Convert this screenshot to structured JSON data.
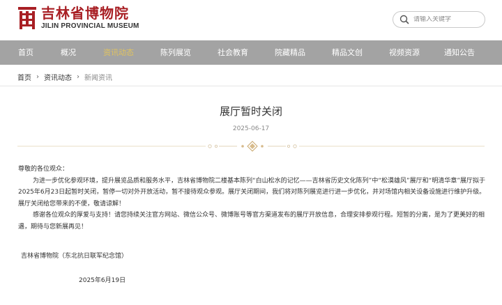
{
  "header": {
    "logo_cn": "吉林省博物院",
    "logo_en": "JILIN PROVINCIAL MUSEUM",
    "search_placeholder": "请输入关键字",
    "brand_color": "#a81f24"
  },
  "nav": {
    "items": [
      {
        "label": "首页"
      },
      {
        "label": "概况"
      },
      {
        "label": "资讯动态",
        "active": true
      },
      {
        "label": "陈列展览"
      },
      {
        "label": "社会教育"
      },
      {
        "label": "院藏精品"
      },
      {
        "label": "精品文创"
      },
      {
        "label": "视频资源"
      },
      {
        "label": "通知公告"
      }
    ],
    "background": "#a3a3a3",
    "active_color": "#e1c35e"
  },
  "breadcrumb": {
    "home": "首页",
    "section": "资讯动态",
    "current": "新闻资讯"
  },
  "article": {
    "title": "展厅暂时关闭",
    "date": "2025-06-17",
    "greeting": "尊敬的各位观众：",
    "paragraph1": "为进一步优化参观环境，提升展览品质和服务水平，吉林省博物院二楼基本陈列“白山松水的记忆——吉林省历史文化陈列”中“松漠雄风”展厅和“明清华章”展厅拟于2025年6月23日起暂时关闭，暂停一切对外开放活动，暂不接待观众参观。展厅关闭期间，我们将对陈列展览进行进一步优化，并对场馆内相关设备设施进行维护升级。展厅关闭给您带来的不便，敬请谅解！",
    "paragraph2": "感谢各位观众的厚爱与支持！请您持续关注官方网站、微信公众号、微博账号等官方渠道发布的展厅开放信息，合理安排参观行程。短暂的分离，是为了更美好的相遇，期待与您新展再见！",
    "signature": "吉林省博物院（东北抗日联军纪念馆）",
    "sign_date": "2025年6月19日"
  }
}
